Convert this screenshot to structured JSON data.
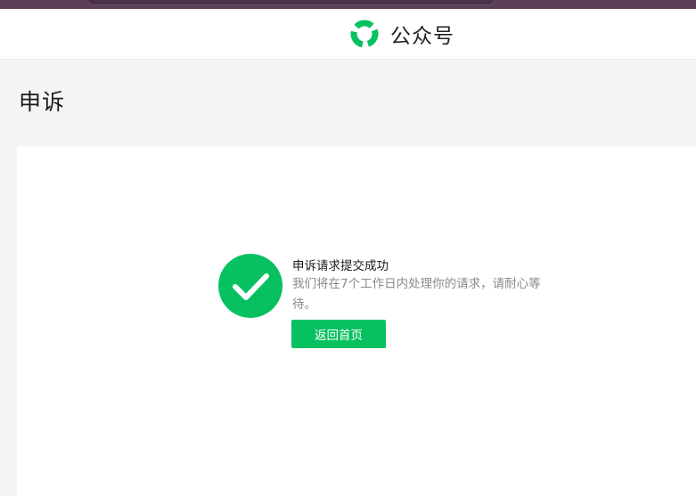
{
  "header": {
    "brand_name": "公众号",
    "logo_icon": "wechat-official-accounts-logo-icon",
    "brand_color": "#07c160"
  },
  "page": {
    "title": "申诉"
  },
  "result": {
    "status_icon": "check-circle-icon",
    "title": "申诉请求提交成功",
    "description": "我们将在7个工作日内处理你的请求，请耐心等待。",
    "button_label": "返回首页"
  }
}
